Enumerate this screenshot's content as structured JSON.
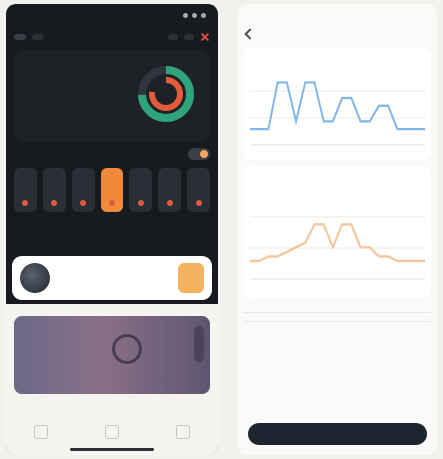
{
  "left": {
    "status": {
      "time": "",
      "signal": ""
    },
    "topbar": {
      "tabs": [
        "",
        "",
        ""
      ],
      "right": [
        "",
        ""
      ]
    },
    "summary": {
      "label": "",
      "rows": [
        {
          "k": "",
          "v": ""
        },
        {
          "k": "",
          "v": ""
        },
        {
          "k": "",
          "v": ""
        }
      ]
    },
    "section_title": "",
    "card": {
      "title": "",
      "subtitle": ""
    },
    "media_section": {
      "title": "",
      "more": ""
    },
    "nav": [
      "",
      "",
      ""
    ],
    "colors": {
      "accent": "#f08a3a",
      "alert": "#e45a3d",
      "bg": "#171a1f"
    }
  },
  "right": {
    "status": {
      "time": "",
      "signal": ""
    },
    "header": {
      "title": ""
    },
    "panel1": {
      "title": ""
    },
    "panel2": {
      "title": ""
    },
    "list": {
      "title": "",
      "items": [
        {
          "left": "",
          "right": ""
        },
        {
          "left": "",
          "right": ""
        }
      ]
    },
    "button": {
      "label": ""
    },
    "colors": {
      "line1": "#7fb7e6",
      "line2": "#f3c59a",
      "button": "#1e2530"
    }
  },
  "chart_data": [
    {
      "type": "line",
      "title": "",
      "x": [
        0,
        1,
        2,
        3,
        4,
        5,
        6,
        7,
        8,
        9,
        10,
        11,
        12,
        13,
        14,
        15,
        16,
        17,
        18,
        19
      ],
      "series": [
        {
          "name": "",
          "values": [
            0.2,
            0.2,
            0.2,
            0.8,
            0.8,
            0.3,
            0.8,
            0.8,
            0.3,
            0.3,
            0.6,
            0.6,
            0.3,
            0.3,
            0.5,
            0.5,
            0.2,
            0.2,
            0.2,
            0.2
          ]
        }
      ],
      "ylim": [
        0,
        1
      ]
    },
    {
      "type": "line",
      "title": "",
      "x": [
        0,
        1,
        2,
        3,
        4,
        5,
        6,
        7,
        8,
        9,
        10,
        11,
        12,
        13,
        14,
        15,
        16,
        17,
        18,
        19
      ],
      "series": [
        {
          "name": "",
          "values": [
            0.2,
            0.2,
            0.25,
            0.25,
            0.3,
            0.35,
            0.4,
            0.6,
            0.6,
            0.35,
            0.6,
            0.6,
            0.35,
            0.35,
            0.25,
            0.25,
            0.2,
            0.2,
            0.2,
            0.2
          ]
        }
      ],
      "ylim": [
        0,
        1
      ]
    }
  ]
}
